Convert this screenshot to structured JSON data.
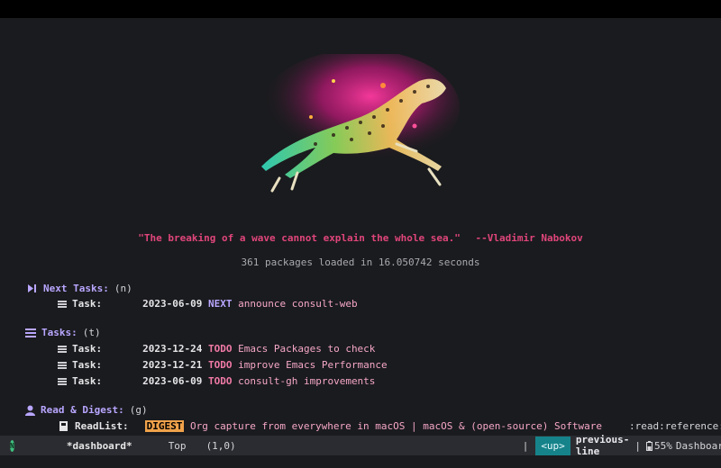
{
  "dashboard": {
    "quote": "\"The breaking of a wave cannot explain the whole sea.\"",
    "quote_author": "--Vladimir Nabokov",
    "packages_loaded": "361 packages loaded in 16.050742 seconds",
    "next_tasks": {
      "title": "Next Tasks:",
      "key": "(n)",
      "items": [
        {
          "label": "Task:",
          "date": "2023-06-09",
          "state": "NEXT",
          "title": "announce consult-web"
        }
      ]
    },
    "tasks": {
      "title": "Tasks:",
      "key": "(t)",
      "items": [
        {
          "label": "Task:",
          "date": "2023-12-24",
          "state": "TODO",
          "title": "Emacs Packages to check"
        },
        {
          "label": "Task:",
          "date": "2023-12-21",
          "state": "TODO",
          "title": "improve Emacs Performance"
        },
        {
          "label": "Task:",
          "date": "2023-06-09",
          "state": "TODO",
          "title": "consult-gh improvements"
        }
      ]
    },
    "read_digest": {
      "title": "Read & Digest:",
      "key": "(g)",
      "items": [
        {
          "label": "ReadList:",
          "state": "DIGEST",
          "title": "Org capture from everywhere in macOS | macOS & (open-source) Software",
          "tags": ":read:reference:web"
        }
      ]
    }
  },
  "modeline": {
    "badge": "N",
    "buffer": "*dashboard*",
    "position": "Top",
    "coords": "(1,0)",
    "separator": "|",
    "key": "<up>",
    "command": "previous-line",
    "battery": "55%",
    "mode": "Dashboard"
  },
  "icons": {
    "next_tasks": "skip-forward-icon",
    "tasks": "list-icon",
    "read_digest": "user-icon",
    "task_row": "list-bullet-icon",
    "readlist_row": "bookmark-icon",
    "battery": "battery-icon",
    "settings": "gear-icon"
  },
  "colors": {
    "background": "#1a1b1e",
    "accent_purple": "#b9a6ff",
    "quote_pink": "#e0457b",
    "todo_pink": "#f07aa5",
    "digest_orange": "#f0a24a",
    "modeline_teal": "#16838a"
  }
}
